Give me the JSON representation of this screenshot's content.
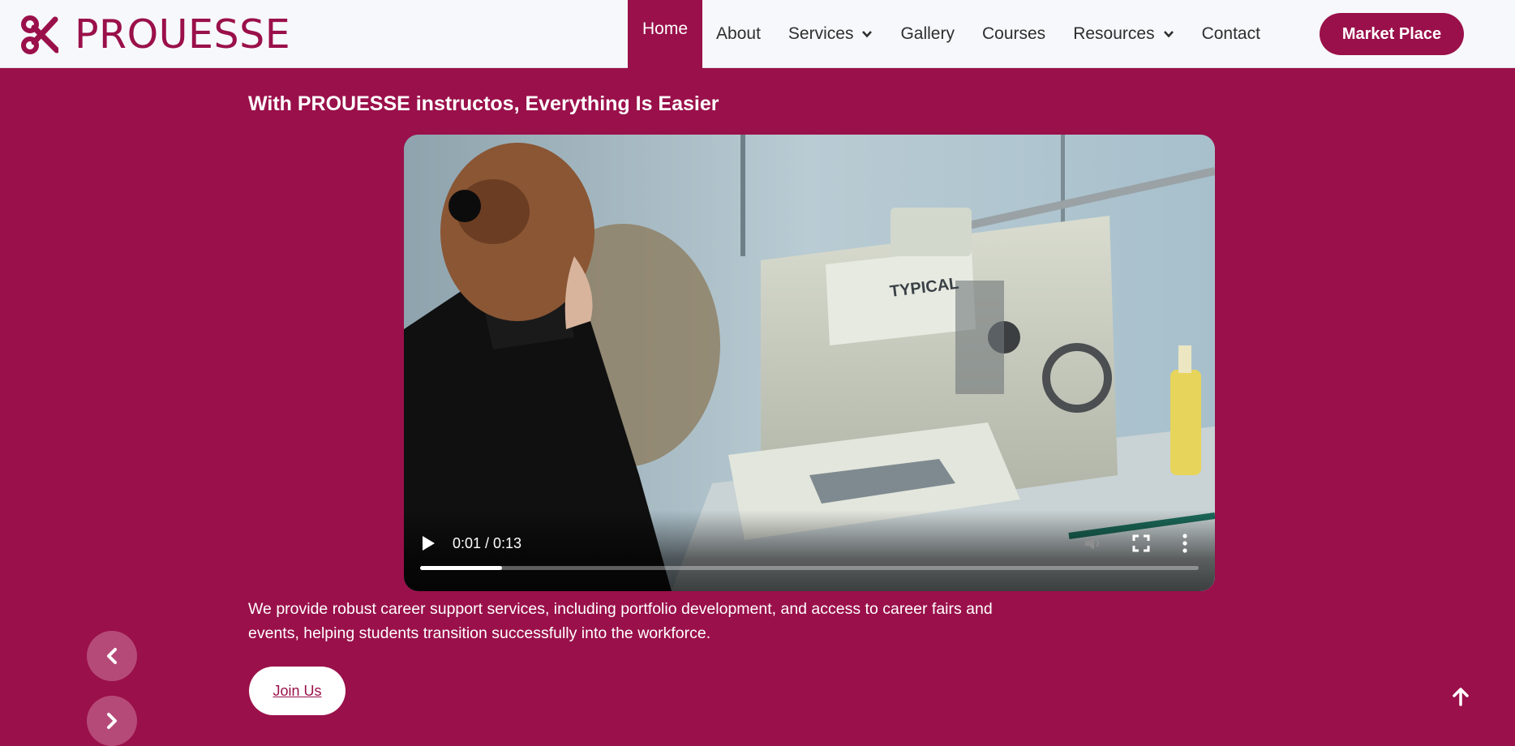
{
  "header": {
    "brand": "PROUESSE",
    "logo_icon": "scissors-icon",
    "nav": [
      {
        "label": "Home",
        "active": true
      },
      {
        "label": "About"
      },
      {
        "label": "Services",
        "dropdown": true
      },
      {
        "label": "Gallery"
      },
      {
        "label": "Courses"
      },
      {
        "label": "Resources",
        "dropdown": true
      },
      {
        "label": "Contact"
      }
    ],
    "cta_label": "Market Place"
  },
  "hero": {
    "headline": "With PROUESSE instructos, Everything Is Easier",
    "video": {
      "time": "0:01 / 0:13",
      "progress": 0.105,
      "machine_brand": "TYPICAL"
    },
    "description": "We provide robust career support services, including portfolio development, and access to career fairs and events, helping students transition successfully into the workforce.",
    "join_label": "Join Us"
  },
  "colors": {
    "brand": "#9a104a",
    "header_bg": "#f7f8fb",
    "arrow_bg": "#b54a78"
  },
  "icons": {
    "prev": "chevron-left-icon",
    "next": "chevron-right-icon",
    "scroll_top": "arrow-up-icon"
  }
}
